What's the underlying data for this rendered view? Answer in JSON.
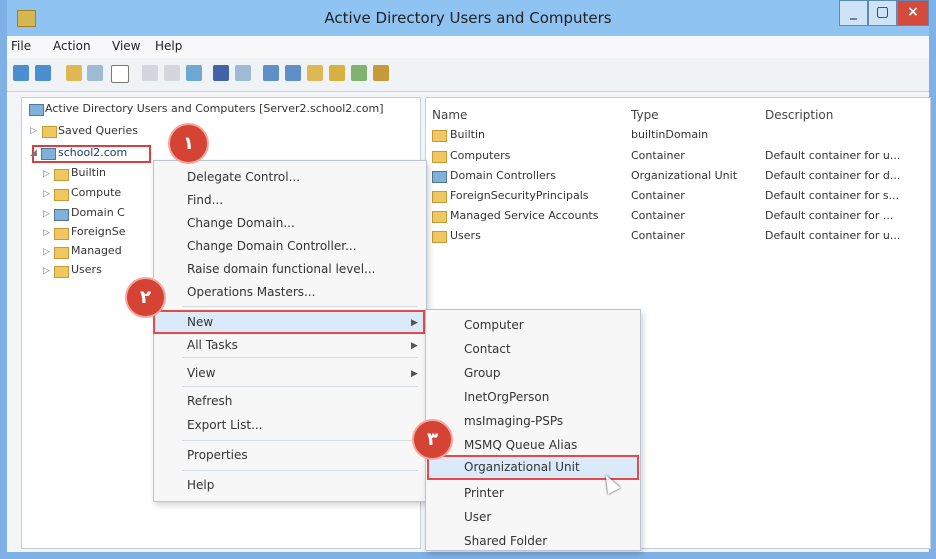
{
  "window": {
    "title": "Active Directory Users and Computers",
    "controls": [
      "_",
      "▢",
      "×"
    ],
    "accent": "#8ec3f2",
    "close_color": "#d44a3c"
  },
  "menu": [
    "File",
    "Action",
    "View",
    "Help"
  ],
  "tree": {
    "root": "Active Directory Users and Computers [Server2.school2.com]",
    "saved_queries": "Saved Queries",
    "domain": "school2.com",
    "children": [
      "Builtin",
      "Compute",
      "Domain C",
      "ForeignSe",
      "Managed",
      "Users"
    ]
  },
  "list": {
    "headers": [
      "Name",
      "Type",
      "Description"
    ],
    "rows": [
      {
        "name": "Builtin",
        "type": "builtinDomain",
        "description": ""
      },
      {
        "name": "Computers",
        "type": "Container",
        "description": "Default container for u..."
      },
      {
        "name": "Domain Controllers",
        "type": "Organizational Unit",
        "description": "Default container for d..."
      },
      {
        "name": "ForeignSecurityPrincipals",
        "type": "Container",
        "description": "Default container for s..."
      },
      {
        "name": "Managed Service Accounts",
        "type": "Container",
        "description": "Default container for ..."
      },
      {
        "name": "Users",
        "type": "Container",
        "description": "Default container for u..."
      }
    ]
  },
  "context_menu": {
    "items": [
      "Delegate Control...",
      "Find...",
      "Change Domain...",
      "Change Domain Controller...",
      "Raise domain functional level...",
      "Operations Masters...",
      "New",
      "All Tasks",
      "View",
      "Refresh",
      "Export List...",
      "Properties",
      "Help"
    ]
  },
  "submenu": {
    "items": [
      "Computer",
      "Contact",
      "Group",
      "InetOrgPerson",
      "msImaging-PSPs",
      "MSMQ Queue Alias",
      "Organizational Unit",
      "Printer",
      "User",
      "Shared Folder"
    ]
  },
  "badges": [
    "۱",
    "۲",
    "۳"
  ]
}
